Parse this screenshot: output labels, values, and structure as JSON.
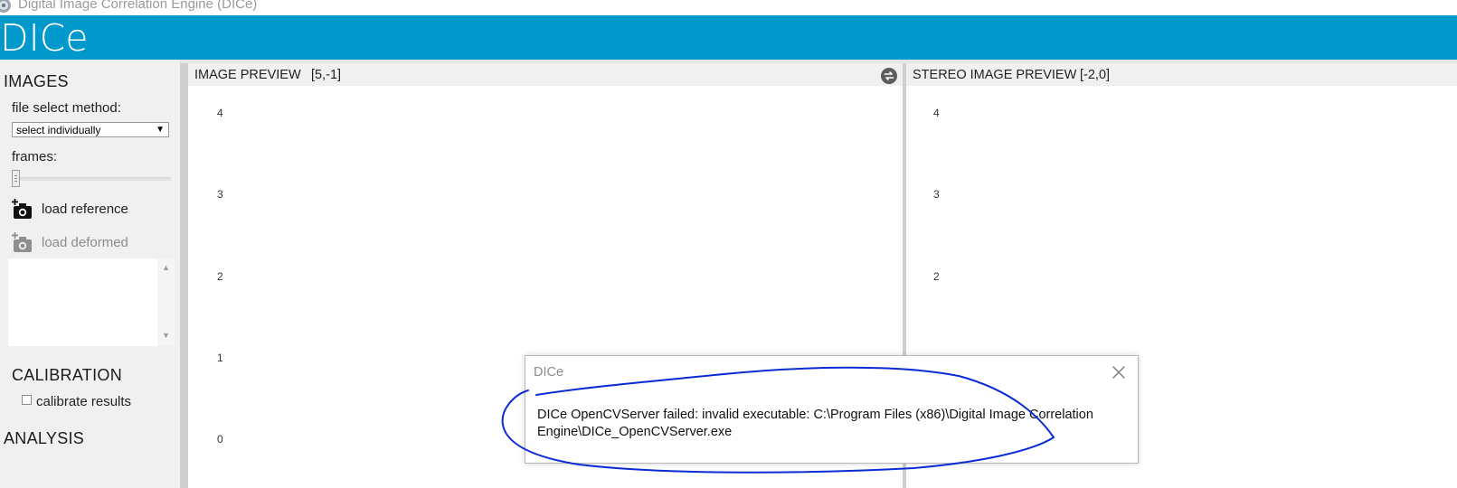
{
  "window": {
    "title": "Digital Image Correlation Engine (DICe)"
  },
  "header": {
    "logo_text": "DICe",
    "brand_color": "#0198cc"
  },
  "sidebar": {
    "images": {
      "title": "IMAGES",
      "file_select_label": "file select method:",
      "file_select_value": "select individually",
      "frames_label": "frames:",
      "load_reference_label": "load reference",
      "load_deformed_label": "load deformed"
    },
    "calibration": {
      "title": "CALIBRATION",
      "calibrate_label": "calibrate results"
    },
    "analysis": {
      "title": "ANALYSIS"
    }
  },
  "image_preview": {
    "title": "IMAGE PREVIEW",
    "coords": "[5,-1]",
    "y_ticks": [
      "4",
      "3",
      "2",
      "1",
      "0"
    ]
  },
  "stereo_preview": {
    "title": "STEREO IMAGE PREVIEW",
    "coords": "[-2,0]",
    "y_ticks": [
      "4",
      "3",
      "2"
    ]
  },
  "dialog": {
    "title": "DICe",
    "message": "DICe OpenCVServer failed: invalid executable: C:\\Program Files (x86)\\Digital Image Correlation Engine\\DICe_OpenCVServer.exe"
  },
  "icons": {
    "app": "dice-app-icon",
    "camera_add": "camera-add-icon",
    "swap": "swap-icon",
    "close": "close-icon"
  }
}
